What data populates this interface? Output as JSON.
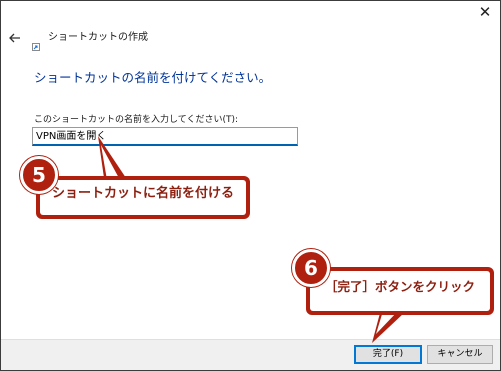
{
  "window": {
    "close_glyph": "✕",
    "back_icon": "arrow-left-icon",
    "wizard_icon": "shortcut-icon",
    "title": "ショートカットの作成"
  },
  "page": {
    "heading": "ショートカットの名前を付けてください。",
    "field_label": "このショートカットの名前を入力してください(T):",
    "field_value": "VPN画面を開く"
  },
  "buttons": {
    "finish": "完了(F)",
    "cancel": "キャンセル"
  },
  "annotations": [
    {
      "number": "5",
      "text": "ショートカットに名前を付ける"
    },
    {
      "number": "6",
      "text": "［完了］ボタンをクリック"
    }
  ],
  "colors": {
    "accent": "#0078d4",
    "heading": "#003399",
    "annotation": "#b0200f"
  }
}
